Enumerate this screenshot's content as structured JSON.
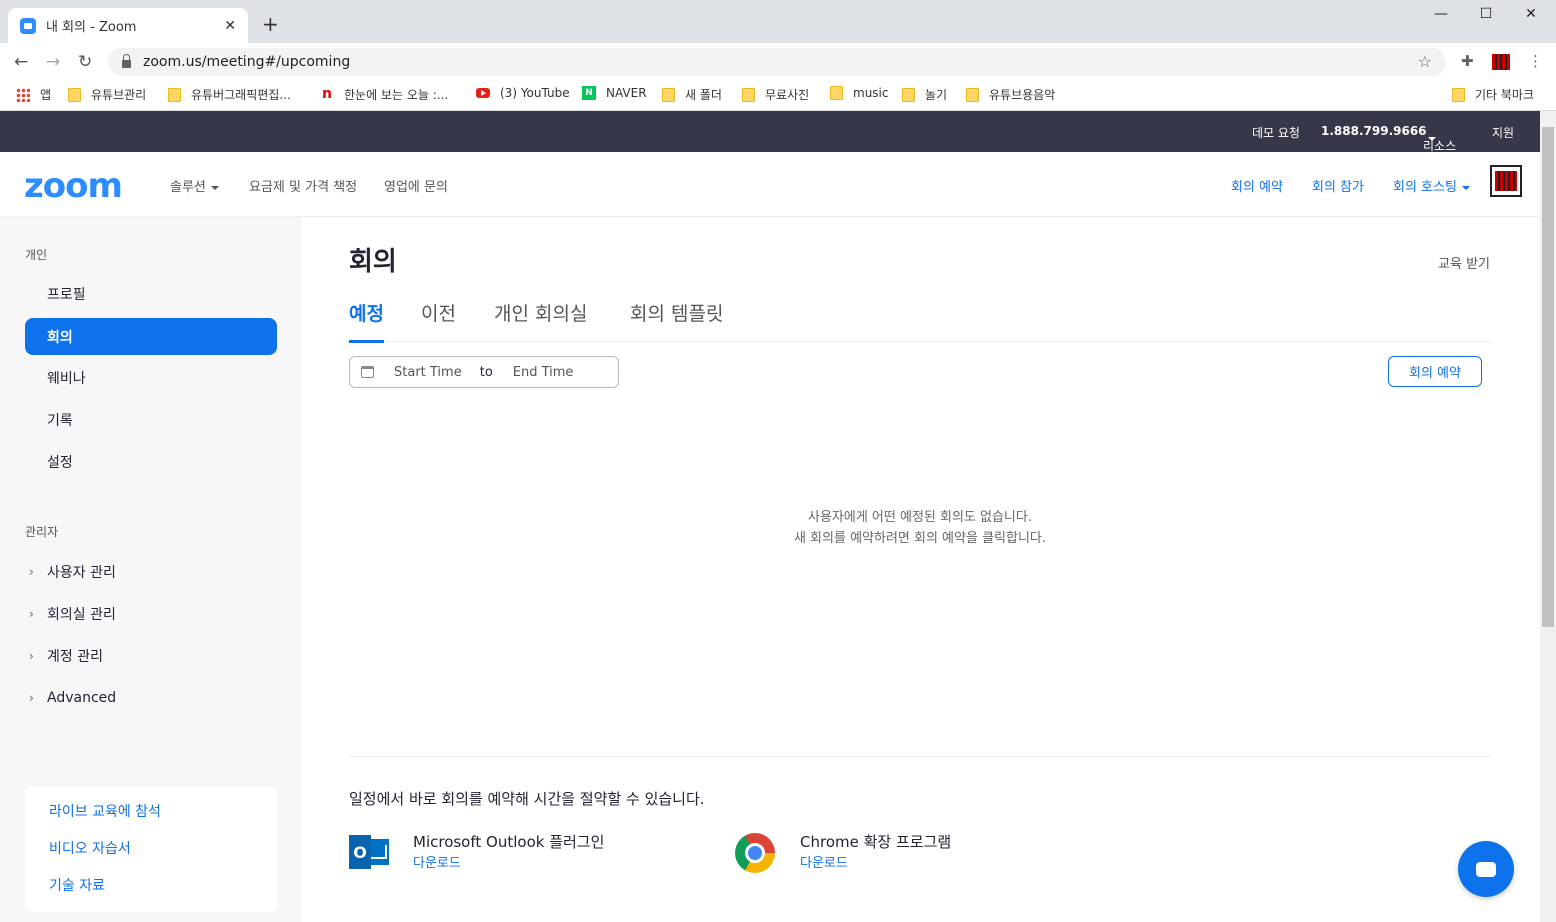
{
  "browser": {
    "tab_title": "내 회의 - Zoom",
    "tab_close": "✕",
    "new_tab": "+",
    "url": "zoom.us/meeting#/upcoming",
    "window_controls": [
      "—",
      "☐",
      "✕"
    ],
    "bookmarks": [
      "앱",
      "유튜브관리",
      "유튜버그래픽편집...",
      "한눈에 보는 오늘 :...",
      "(3) YouTube",
      "NAVER",
      "새 폴더",
      "무료사진",
      "music",
      "놀기",
      "유튜브용음악"
    ],
    "other_bookmarks": "기타 북마크"
  },
  "topbar": {
    "demo": "데모 요청",
    "phone": "1.888.799.9666",
    "resources": "리소스",
    "support": "지원"
  },
  "header": {
    "logo": "zoom",
    "solutions": "솔루션",
    "pricing": "요금제 및 가격 책정",
    "sales": "영업에 문의",
    "schedule": "회의 예약",
    "join": "회의 참가",
    "host": "회의 호스팅"
  },
  "sidebar": {
    "personal_label": "개인",
    "personal_items": [
      "프로필",
      "회의",
      "웨비나",
      "기록",
      "설정"
    ],
    "admin_label": "관리자",
    "admin_items": [
      "사용자 관리",
      "회의실 관리",
      "계정 관리",
      "Advanced"
    ],
    "learn_links": [
      "라이브 교육에 참석",
      "비디오 자습서",
      "기술 자료"
    ]
  },
  "main": {
    "title": "회의",
    "training": "교육 받기",
    "tabs": [
      "예정",
      "이전",
      "개인 회의실",
      "회의 템플릿"
    ],
    "start_placeholder": "Start Time",
    "to": "to",
    "end_placeholder": "End Time",
    "schedule_button": "회의 예약",
    "empty_line1": "사용자에게 어떤 예정된 회의도 없습니다.",
    "empty_line2": "새 회의를 예약하려면 회의 예약을 클릭합니다.",
    "promo": "일정에서 바로 회의를 예약해 시간을 절약할 수 있습니다.",
    "outlook_name": "Microsoft Outlook 플러그인",
    "chrome_name": "Chrome 확장 프로그램",
    "download": "다운로드"
  },
  "colors": {
    "brand": "#2d8cff",
    "link": "#0e72ed",
    "topbar": "#363849"
  }
}
